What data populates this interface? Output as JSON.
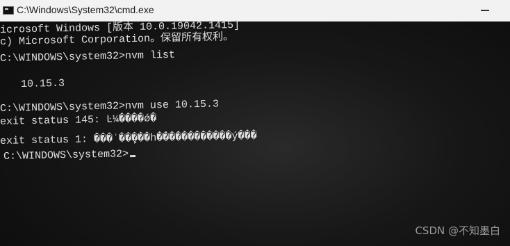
{
  "window": {
    "title": "C:\\Windows\\System32\\cmd.exe"
  },
  "console": {
    "lines": [
      "icrosoft Windows [版本 10.0.19042.1415]",
      "c) Microsoft Corporation。保留所有权利。",
      "C:\\WINDOWS\\system32>nvm list",
      "10.15.3",
      "C:\\WINDOWS\\system32>nvm use 10.15.3",
      "exit status 145: Ŀ¼����ǿ�",
      "exit status 1: ���ʾ��ܾ���һ������������ý���",
      "C:\\WINDOWS\\system32>"
    ]
  },
  "watermark": {
    "text": "CSDN @不知墨白"
  }
}
